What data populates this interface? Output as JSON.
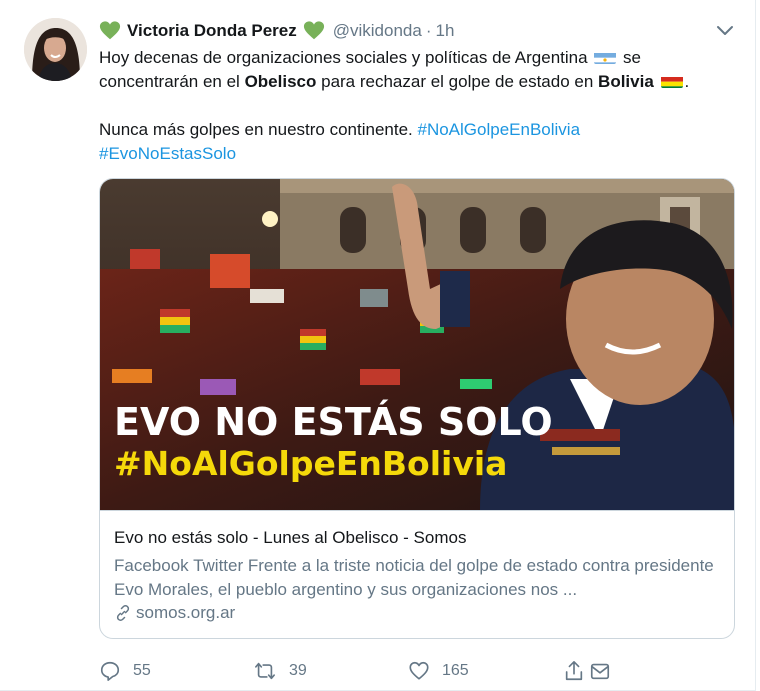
{
  "tweet": {
    "author_name": "Victoria Donda Perez",
    "author_handle": "@vikidonda",
    "separator": "·",
    "time": "1h",
    "text": {
      "p1_a": "Hoy decenas de organizaciones sociales y políticas de Argentina",
      "p1_b": "se concentrarán en el",
      "p1_obelisco": "Obelisco",
      "p1_c": "para rechazar el golpe de estado en",
      "p1_bolivia": "Bolivia",
      "p1_end": ".",
      "p2": "Nunca más golpes en nuestro continente.",
      "hashtag1": "#NoAlGolpeEnBolivia",
      "hashtag2": "#EvoNoEstasSolo"
    }
  },
  "card": {
    "image_line1": "EVO NO ESTÁS SOLO",
    "image_line2": "#NoAlGolpeEnBolivia",
    "title": "Evo no estás solo - Lunes al Obelisco - Somos",
    "description": "Facebook Twitter Frente a la triste noticia del golpe de estado contra presidente Evo Morales, el pueblo argentino y sus organizaciones nos ...",
    "domain": "somos.org.ar"
  },
  "actions": {
    "replies": "55",
    "retweets": "39",
    "likes": "165"
  },
  "colors": {
    "accent": "#1b95e0",
    "muted": "#657786",
    "heart_green": "#78b159",
    "overlay_yellow": "#f5d90a"
  },
  "icons": [
    "green-heart-icon",
    "caret-down-icon",
    "argentina-flag-icon",
    "bolivia-flag-icon",
    "link-icon",
    "reply-icon",
    "retweet-icon",
    "like-icon",
    "share-icon",
    "direct-message-icon"
  ]
}
